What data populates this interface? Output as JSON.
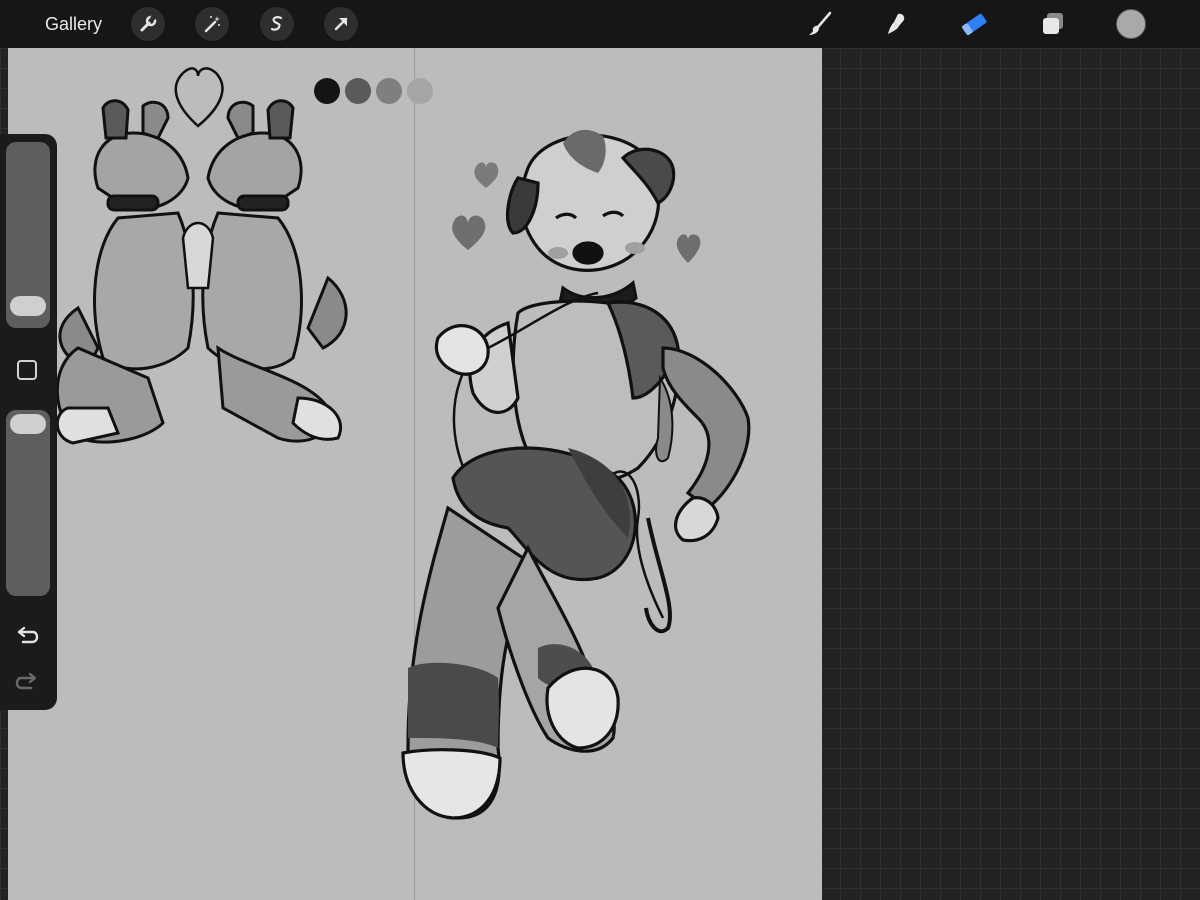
{
  "topbar": {
    "gallery_label": "Gallery",
    "tools_left": [
      "wrench-icon",
      "magic-wand-icon",
      "selection-s-icon",
      "move-arrow-icon"
    ],
    "tools_right": [
      "brush-icon",
      "smudge-icon",
      "eraser-icon",
      "layers-icon"
    ],
    "active_tool": "eraser",
    "accent_color": "#2f7ff5",
    "current_color": "#a9a9a9"
  },
  "sidebar": {
    "size_slider_level": 0.05,
    "opacity_slider_level": 1.0,
    "modify_button": "modify-square-icon",
    "undo": "undo-icon",
    "redo": "redo-icon",
    "redo_enabled": false
  },
  "canvas": {
    "background_color": "#bcbcbc",
    "palette_dots": [
      "#141414",
      "#5a5a5a",
      "#7f7f7f",
      "#a5a5a5"
    ]
  }
}
